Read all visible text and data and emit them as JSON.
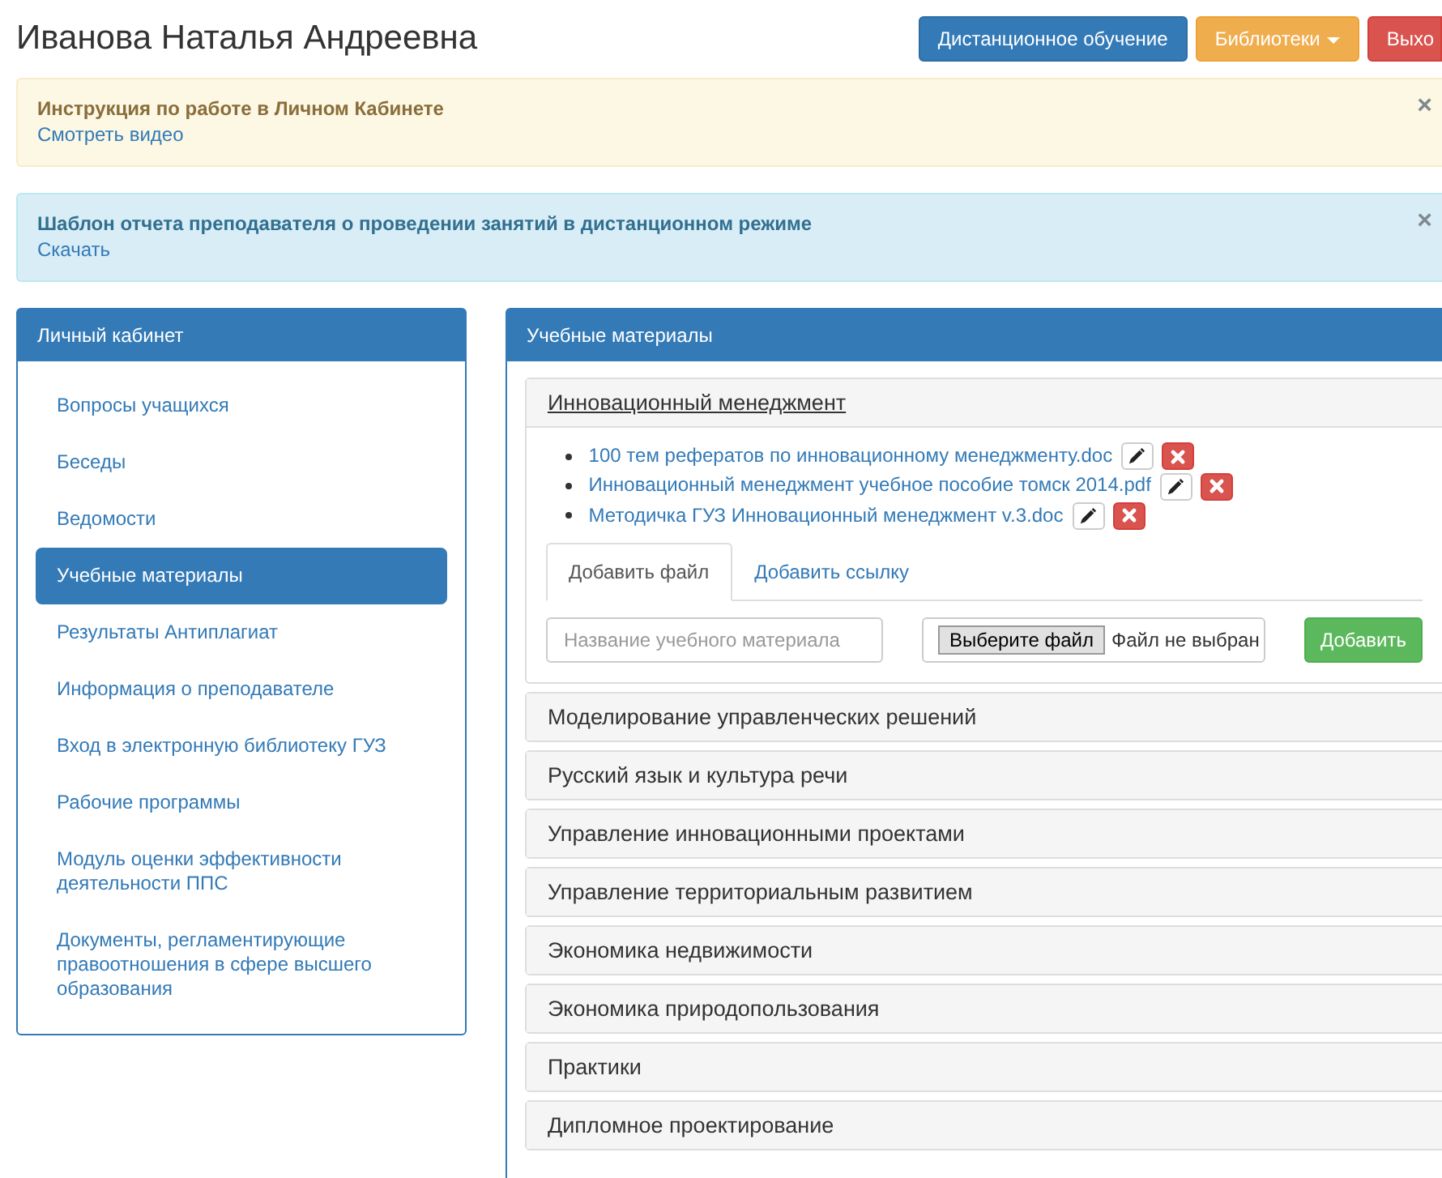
{
  "user_name": "Иванова Наталья Андреевна",
  "header_buttons": [
    {
      "kind": "primary",
      "label": "Дистанционное обучение",
      "dropdown": false
    },
    {
      "kind": "warning",
      "label": "Библиотеки",
      "dropdown": true
    },
    {
      "kind": "danger",
      "label": "Выхо",
      "dropdown": false
    }
  ],
  "alerts": [
    {
      "kind": "warning",
      "title": "Инструкция по работе в Личном Кабинете",
      "link": "Смотреть видео",
      "close": "×"
    },
    {
      "kind": "info",
      "title": "Шаблон отчета преподавателя о проведении занятий в дистанционном режиме",
      "link": "Скачать",
      "close": "×"
    }
  ],
  "sidebar": {
    "title": "Личный кабинет",
    "items": [
      {
        "label": "Вопросы учащихся",
        "selected": false
      },
      {
        "label": "Беседы",
        "selected": false
      },
      {
        "label": "Ведомости",
        "selected": false
      },
      {
        "label": "Учебные материалы",
        "selected": true
      },
      {
        "label": "Результаты Антиплагиат",
        "selected": false
      },
      {
        "label": "Информация о преподавателе",
        "selected": false
      },
      {
        "label": "Вход в электронную библиотеку ГУЗ",
        "selected": false
      },
      {
        "label": "Рабочие программы",
        "selected": false
      },
      {
        "label": "Модуль оценки эффективности деятельности ППС",
        "selected": false
      },
      {
        "label": "Документы, регламентирующие правоотношения в сфере высшего образования",
        "selected": false
      }
    ]
  },
  "materials": {
    "title": "Учебные материалы",
    "subjects": [
      {
        "title": "Инновационный менеджмент",
        "expanded": true,
        "files": [
          "100 тем рефератов по инновационному менеджменту.doc",
          "Инновационный менеджмент учебное пособие томск 2014.pdf",
          "Методичка ГУЗ Инновационный менеджмент v.3.doc"
        ],
        "tabs": [
          {
            "label": "Добавить файл",
            "selected": true
          },
          {
            "label": "Добавить ссылку",
            "selected": false
          }
        ],
        "name_placeholder": "Название учебного материала",
        "file_button": "Выберите файл",
        "file_status": "Файл не выбран",
        "add_button": "Добавить"
      },
      {
        "title": "Моделирование управленческих решений",
        "expanded": false
      },
      {
        "title": "Русский язык и культура речи",
        "expanded": false
      },
      {
        "title": "Управление инновационными проектами",
        "expanded": false
      },
      {
        "title": "Управление территориальным развитием",
        "expanded": false
      },
      {
        "title": "Экономика недвижимости",
        "expanded": false
      },
      {
        "title": "Экономика природопользования",
        "expanded": false
      },
      {
        "title": "Практики",
        "expanded": false
      },
      {
        "title": "Дипломное проектирование",
        "expanded": false
      }
    ]
  }
}
